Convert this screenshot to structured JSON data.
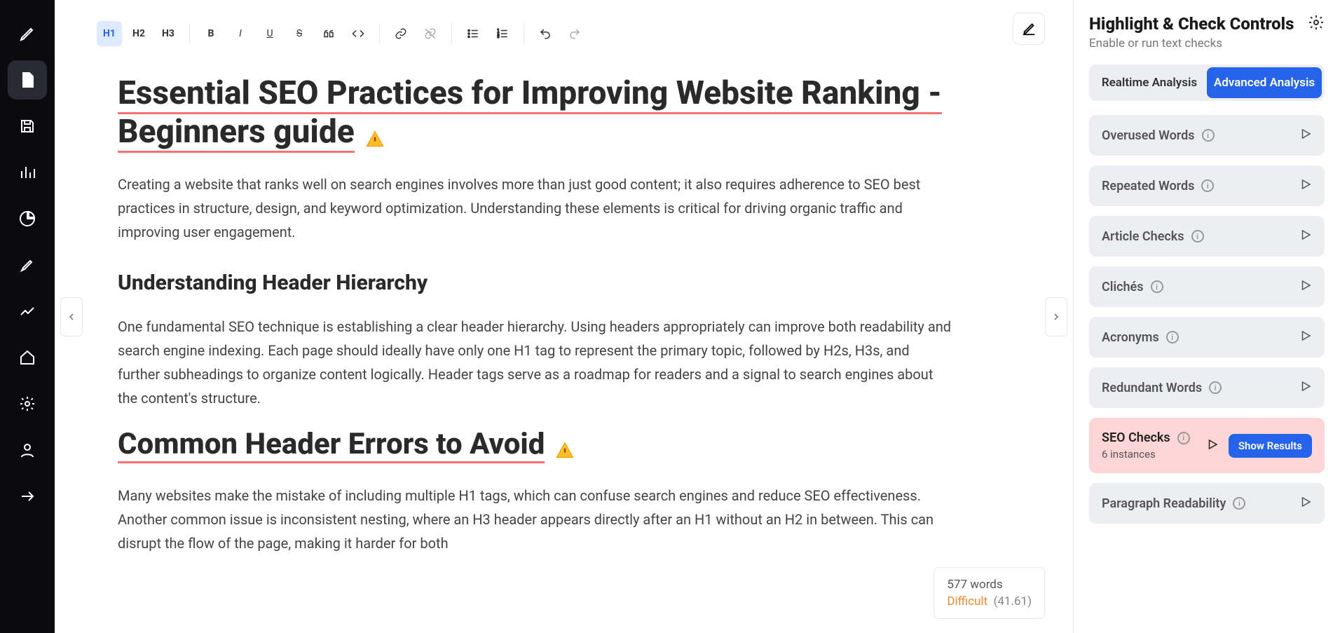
{
  "toolbar": {
    "h1": "H1",
    "h2": "H2",
    "h3": "H3"
  },
  "document": {
    "title": "Essential SEO Practices for Improving Website Ranking - Beginners guide",
    "p1": "Creating a website that ranks well on search engines involves more than just good content; it also requires adherence to SEO best practices in structure, design, and keyword optimization. Understanding these elements is critical for driving organic traffic and improving user engagement.",
    "h2a": "Understanding Header Hierarchy",
    "p2": "One fundamental SEO technique is establishing a clear header hierarchy. Using headers appropriately can improve both readability and search engine indexing. Each page should ideally have only one H1 tag to represent the primary topic, followed by H2s, H3s, and further subheadings to organize content logically. Header tags serve as a roadmap for readers and a signal to search engines about the content's structure.",
    "h2b": "Common Header Errors to Avoid",
    "p3": "Many websites make the mistake of including multiple H1 tags, which can confuse search engines and reduce SEO effectiveness. Another common issue is inconsistent nesting, where an H3 header appears directly after an H1 without an H2 in between. This can disrupt the flow of the page, making it harder for both"
  },
  "stats": {
    "words": "577 words",
    "difficulty": "Difficult",
    "score": "(41.61)"
  },
  "panel": {
    "title": "Highlight & Check Controls",
    "subtitle": "Enable or run text checks",
    "tabs": {
      "realtime": "Realtime Analysis",
      "advanced": "Advanced Analysis"
    },
    "checks": {
      "overused": "Overused Words",
      "repeated": "Repeated Words",
      "article": "Article Checks",
      "cliches": "Clichés",
      "acronyms": "Acronyms",
      "redundant": "Redundant Words",
      "seo": "SEO Checks",
      "seo_instances": "6 instances",
      "readability": "Paragraph Readability",
      "show_results": "Show Results"
    }
  }
}
